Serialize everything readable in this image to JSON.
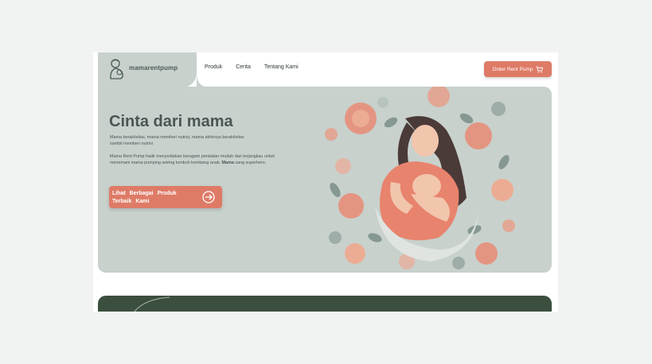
{
  "brand": {
    "name": "mamarentpump"
  },
  "nav": {
    "items": [
      "Produk",
      "Cerita",
      "Tentang Kami"
    ]
  },
  "header": {
    "order_button": "Order Rent Pump"
  },
  "hero": {
    "title": "Cinta dari mama",
    "subtitle": "Mama beraktivitas, mama memberi nutrisi, mama akhirnya beraktivitas sambil memberi nutrisi",
    "body_pre": "Mama Rent Pump hadir menyediakan beragam peralatan mudah dan terjangkau untuk menemani mama pumping seiring tumbuh kembang anak.",
    "body_bold": "Mama",
    "body_post": " sang superhero.",
    "cta_label": "Lihat Berbagai Produk Terbaik Kami"
  },
  "colors": {
    "accent": "#de7b67",
    "hero_bg": "#c8d1cc",
    "section_dark": "#3b4f3e",
    "page_bg": "#f1f3f2"
  },
  "icons": {
    "logo": "mother-baby-logo-icon",
    "cart": "cart-icon",
    "cta": "arrow-right-circle-icon"
  }
}
